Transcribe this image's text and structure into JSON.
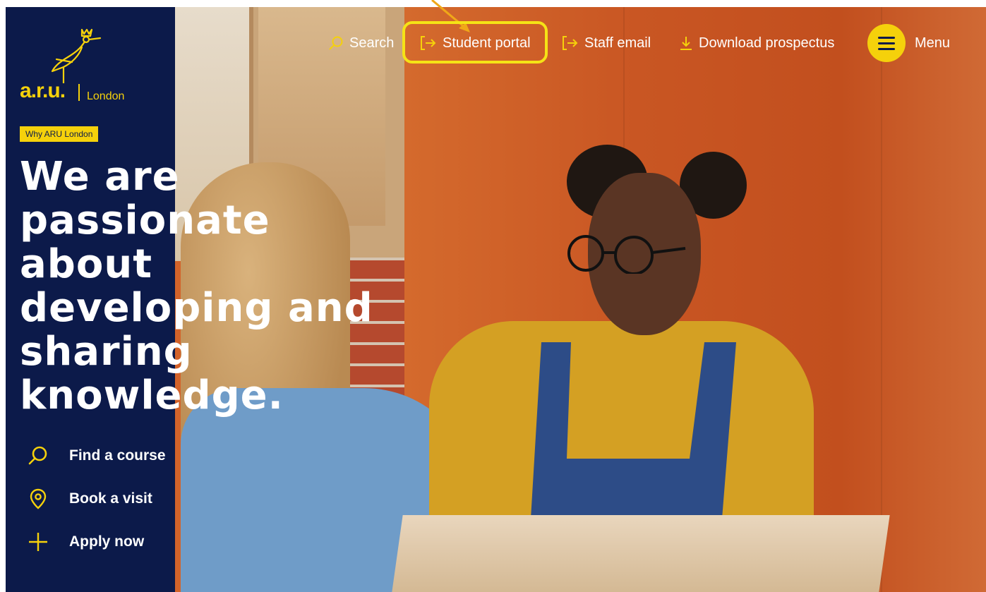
{
  "nav": {
    "search_label": "Search",
    "student_portal_label": "Student portal",
    "staff_email_label": "Staff email",
    "download_prospectus_label": "Download prospectus",
    "menu_label": "Menu"
  },
  "logo": {
    "brand": "a.r.u.",
    "campus": "London"
  },
  "hero": {
    "tag": "Why ARU London",
    "headline_lines": [
      "We are",
      "passionate",
      "about",
      "developing and",
      "sharing",
      "knowledge."
    ]
  },
  "quick_links": [
    {
      "label": "Find a course",
      "icon": "search-icon"
    },
    {
      "label": "Book a visit",
      "icon": "location-pin-icon"
    },
    {
      "label": "Apply now",
      "icon": "plus-icon"
    }
  ],
  "colors": {
    "navy": "#0c1a4a",
    "yellow": "#f5d10b",
    "highlight": "#f5e316"
  }
}
